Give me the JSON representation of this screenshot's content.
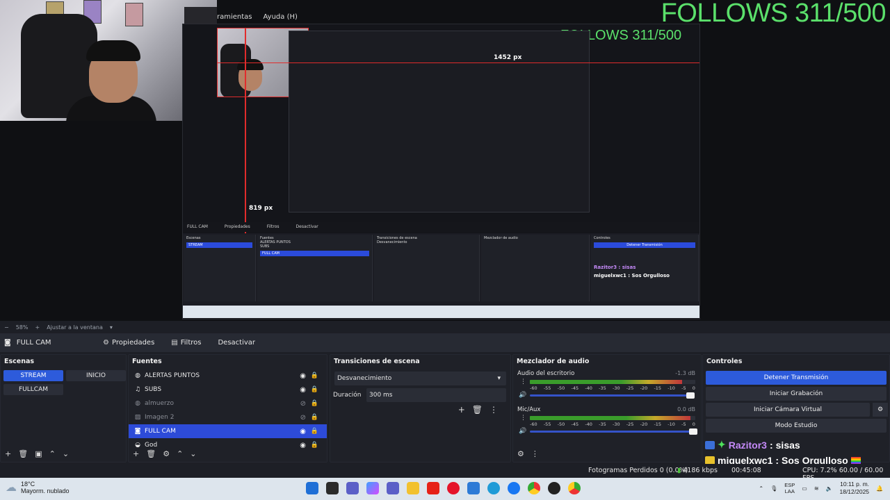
{
  "menu": {
    "items": [
      "ramientas",
      "Ayuda (H)"
    ]
  },
  "overlay": {
    "follows": "FOLLOWS 311/500",
    "px_width": "1452 px",
    "px_height": "819 px",
    "nested_chat_1": "Razitor3 : sisas",
    "nested_chat_2": "miguelxwc1 : Sos Orgulloso"
  },
  "preview_zoom": {
    "zoom": "58%",
    "fit": "Ajustar a la ventana"
  },
  "scene_toolbar": {
    "current_source": "FULL CAM",
    "properties": "Propiedades",
    "filters": "Filtros",
    "deactivate": "Desactivar"
  },
  "scenes": {
    "title": "Escenas",
    "items": [
      {
        "label": "STREAM",
        "active": true
      },
      {
        "label": "INICIO",
        "active": false
      },
      {
        "label": "FULLCAM",
        "active": false
      }
    ]
  },
  "sources": {
    "title": "Fuentes",
    "items": [
      {
        "label": "ALERTAS PUNTOS",
        "icon": "globe-icon",
        "visible": true,
        "selected": false
      },
      {
        "label": "SUBS",
        "icon": "music-icon",
        "visible": true,
        "selected": false
      },
      {
        "label": "almuerzo",
        "icon": "globe-icon",
        "visible": false,
        "selected": false
      },
      {
        "label": "Imagen 2",
        "icon": "image-icon",
        "visible": false,
        "selected": false
      },
      {
        "label": "FULL CAM",
        "icon": "camera-icon",
        "visible": true,
        "selected": true
      },
      {
        "label": "God",
        "icon": "gamepad-icon",
        "visible": true,
        "selected": false
      }
    ]
  },
  "transitions": {
    "title": "Transiciones de escena",
    "selected": "Desvanecimiento",
    "duration_label": "Duración",
    "duration_value": "300 ms"
  },
  "mixer": {
    "title": "Mezclador de audio",
    "ticks": [
      "-60",
      "-55",
      "-50",
      "-45",
      "-40",
      "-35",
      "-30",
      "-25",
      "-20",
      "-15",
      "-10",
      "-5",
      "0"
    ],
    "tracks": [
      {
        "name": "Audio del escritorio",
        "db": "-1.3 dB",
        "level": 0.92,
        "volume": 0.98
      },
      {
        "name": "Mic/Aux",
        "db": "0.0 dB",
        "level": 0.97,
        "volume": 1.0
      }
    ]
  },
  "controls": {
    "title": "Controles",
    "stop_stream": "Detener Transmisión",
    "start_recording": "Iniciar Grabación",
    "virtual_cam": "Iniciar Cámara Virtual",
    "studio_mode": "Modo Estudio"
  },
  "chat": [
    {
      "user": "Razitor3",
      "message": "sisas",
      "user_color": "#c58af9"
    },
    {
      "user": "miguelxwc1",
      "message": "Sos Orgulloso",
      "user_color": "#ffffff"
    }
  ],
  "status": {
    "dropped_frames": "Fotogramas Perdidos 0 (0.0%)",
    "kbps": "4186 kbps",
    "stream_time": "00:45:08",
    "cpu_fps": "CPU: 7.2%   60.00 / 60.00 FPS"
  },
  "taskbar": {
    "weather_temp": "18°C",
    "weather_desc": "Mayorm. nublado",
    "lang_1": "ESP",
    "lang_2": "LAA",
    "time": "10:11 p. m.",
    "date": "18/12/2025"
  },
  "colors": {
    "accent": "#2d5bdb",
    "follows_green": "#5be06b",
    "recording_red": "#e12c2c"
  }
}
